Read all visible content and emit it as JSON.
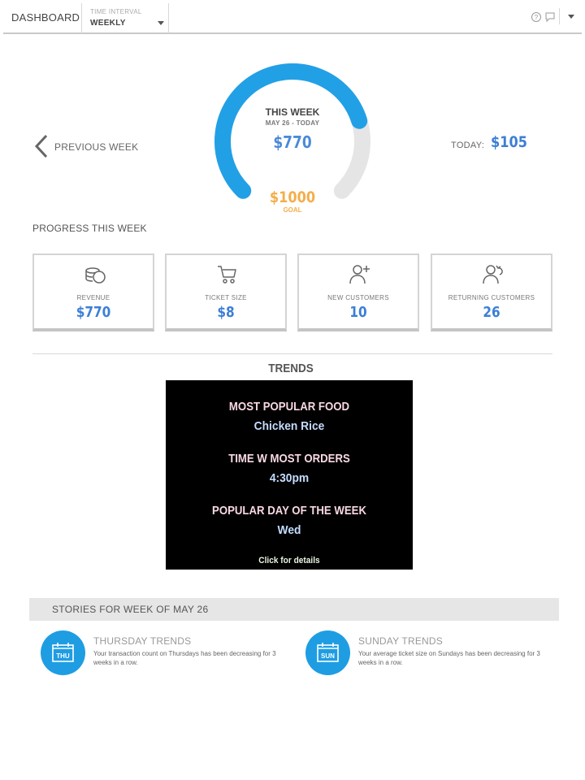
{
  "header": {
    "title": "DASHBOARD",
    "interval_label": "TIME INTERVAL",
    "interval_value": "WEEKLY"
  },
  "gauge": {
    "heading": "THIS WEEK",
    "date_range": "MAY 26 - TODAY",
    "amount": "$770",
    "goal_amount": "$1000",
    "goal_label": "GOAL",
    "progress_fraction": 0.77,
    "colors": {
      "progress": "#22a0e6",
      "track": "#e5e5e5",
      "goal": "#f4ae4a"
    }
  },
  "prev_week": {
    "label": "PREVIOUS WEEK"
  },
  "today": {
    "label": "TODAY:",
    "value": "$105"
  },
  "progress": {
    "title": "PROGRESS THIS WEEK",
    "cards": [
      {
        "label": "REVENUE",
        "value": "$770",
        "icon": "coins-icon"
      },
      {
        "label": "TICKET SIZE",
        "value": "$8",
        "icon": "cart-icon"
      },
      {
        "label": "NEW CUSTOMERS",
        "value": "10",
        "icon": "add-user-icon"
      },
      {
        "label": "RETURNING CUSTOMERS",
        "value": "26",
        "icon": "returning-user-icon"
      }
    ]
  },
  "trends": {
    "title": "TRENDS",
    "items": [
      {
        "heading": "MOST POPULAR FOOD",
        "value": "Chicken Rice"
      },
      {
        "heading": "TIME W MOST ORDERS",
        "value": "4:30pm"
      },
      {
        "heading": "POPULAR DAY OF THE WEEK",
        "value": "Wed"
      }
    ],
    "link": "Click for details"
  },
  "stories": {
    "title": "STORIES FOR WEEK OF MAY 26",
    "items": [
      {
        "day": "THU",
        "title": "THURSDAY TRENDS",
        "text": "Your transaction count on Thursdays has been decreasing for 3 weeks in a row."
      },
      {
        "day": "SUN",
        "title": "SUNDAY TRENDS",
        "text": "Your average ticket size on Sundays has been decreasing for 3 weeks in a row."
      }
    ]
  }
}
